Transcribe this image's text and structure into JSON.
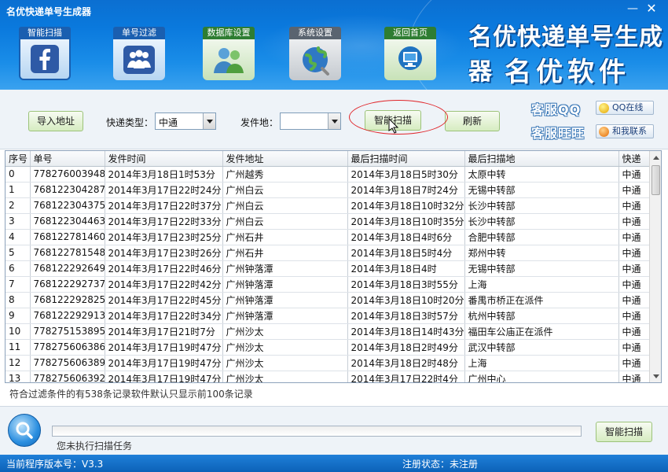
{
  "window": {
    "title": "名优快递单号生成器",
    "min_glyph": "—",
    "close_glyph": "✕"
  },
  "brand": {
    "line1": "名优快递单号生成器",
    "line2": "名优软件"
  },
  "nav": [
    {
      "label": "智能扫描",
      "icon": "facebook-icon",
      "color": "#1a5fb0"
    },
    {
      "label": "单号过滤",
      "icon": "people-icon",
      "color": "#1a5fb0"
    },
    {
      "label": "数据库设置",
      "icon": "users-icon",
      "color": "#2e7d32"
    },
    {
      "label": "系统设置",
      "icon": "globe-icon",
      "color": "#5a6470"
    },
    {
      "label": "返回首页",
      "icon": "monitor-icon",
      "color": "#2e7d32"
    }
  ],
  "toolbar": {
    "import_label": "导入地址",
    "type_label": "快递类型：",
    "type_value": "中通",
    "origin_label": "发件地：",
    "origin_value": "",
    "scan_label": "智能扫描",
    "refresh_label": "刷新"
  },
  "service": {
    "kf_qq_label": "客服QQ",
    "kf_qq_button": "QQ在线",
    "kf_ww_label": "客服旺旺",
    "kf_ww_button": "和我联系"
  },
  "table": {
    "columns": [
      "序号",
      "单号",
      "发件时间",
      "发件地址",
      "最后扫描时间",
      "最后扫描地",
      "快递"
    ],
    "rows": [
      [
        "0",
        "778276003948",
        "2014年3月18日1时53分",
        "广州越秀",
        "2014年3月18日5时30分",
        "太原中转",
        "中通"
      ],
      [
        "1",
        "768122304287",
        "2014年3月17日22时24分",
        "广州白云",
        "2014年3月18日7时24分",
        "无锡中转部",
        "中通"
      ],
      [
        "2",
        "768122304375",
        "2014年3月17日22时37分",
        "广州白云",
        "2014年3月18日10时32分",
        "长沙中转部",
        "中通"
      ],
      [
        "3",
        "768122304463",
        "2014年3月17日22时33分",
        "广州白云",
        "2014年3月18日10时35分",
        "长沙中转部",
        "中通"
      ],
      [
        "4",
        "768122781460",
        "2014年3月17日23时25分",
        "广州石井",
        "2014年3月18日4时6分",
        "合肥中转部",
        "中通"
      ],
      [
        "5",
        "768122781548",
        "2014年3月17日23时26分",
        "广州石井",
        "2014年3月18日5时4分",
        "郑州中转",
        "中通"
      ],
      [
        "6",
        "768122292649",
        "2014年3月17日22时46分",
        "广州钟落潭",
        "2014年3月18日4时",
        "无锡中转部",
        "中通"
      ],
      [
        "7",
        "768122292737",
        "2014年3月17日22时42分",
        "广州钟落潭",
        "2014年3月18日3时55分",
        "上海",
        "中通"
      ],
      [
        "8",
        "768122292825",
        "2014年3月17日22时45分",
        "广州钟落潭",
        "2014年3月18日10时20分",
        "番禺市桥正在派件",
        "中通"
      ],
      [
        "9",
        "768122292913",
        "2014年3月17日22时34分",
        "广州钟落潭",
        "2014年3月18日3时57分",
        "杭州中转部",
        "中通"
      ],
      [
        "10",
        "778275153895",
        "2014年3月17日21时7分",
        "广州沙太",
        "2014年3月18日14时43分",
        "福田车公庙正在派件",
        "中通"
      ],
      [
        "11",
        "778275606386",
        "2014年3月17日19时47分",
        "广州沙太",
        "2014年3月18日2时49分",
        "武汉中转部",
        "中通"
      ],
      [
        "12",
        "778275606389",
        "2014年3月17日19时47分",
        "广州沙太",
        "2014年3月18日2时48分",
        "上海",
        "中通"
      ],
      [
        "13",
        "778275606392",
        "2014年3月17日19时47分",
        "广州沙太",
        "2014年3月17日22时4分",
        "广州中心",
        "中通"
      ]
    ]
  },
  "summary": "符合过滤条件的有538条记录软件默认只显示前100条记录",
  "scan": {
    "status": "您未执行扫描任务",
    "button": "智能扫描"
  },
  "statusbar": {
    "version": "当前程序版本号：V3.3",
    "register": "注册状态：未注册"
  }
}
